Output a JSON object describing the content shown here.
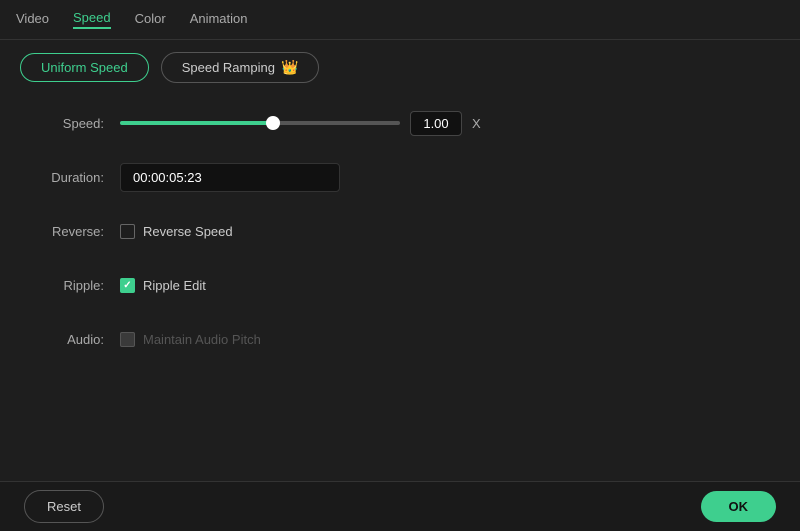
{
  "topNav": {
    "items": [
      {
        "id": "video",
        "label": "Video",
        "active": false
      },
      {
        "id": "speed",
        "label": "Speed",
        "active": true
      },
      {
        "id": "color",
        "label": "Color",
        "active": false
      },
      {
        "id": "animation",
        "label": "Animation",
        "active": false
      }
    ]
  },
  "subTabs": {
    "uniformSpeed": {
      "label": "Uniform Speed",
      "active": true
    },
    "speedRamping": {
      "label": "Speed Ramping",
      "active": false
    }
  },
  "form": {
    "speedLabel": "Speed:",
    "speedValue": "1.00",
    "speedUnit": "X",
    "durationLabel": "Duration:",
    "durationValue": "00:00:05:23",
    "reverseLabel": "Reverse:",
    "reverseCheckboxLabel": "Reverse Speed",
    "rippleLabel": "Ripple:",
    "rippleCheckboxLabel": "Ripple Edit",
    "audioLabel": "Audio:",
    "audioCheckboxLabel": "Maintain Audio Pitch"
  },
  "footer": {
    "resetLabel": "Reset",
    "okLabel": "OK"
  },
  "icons": {
    "crown": "👑",
    "checkmark": "✓"
  }
}
